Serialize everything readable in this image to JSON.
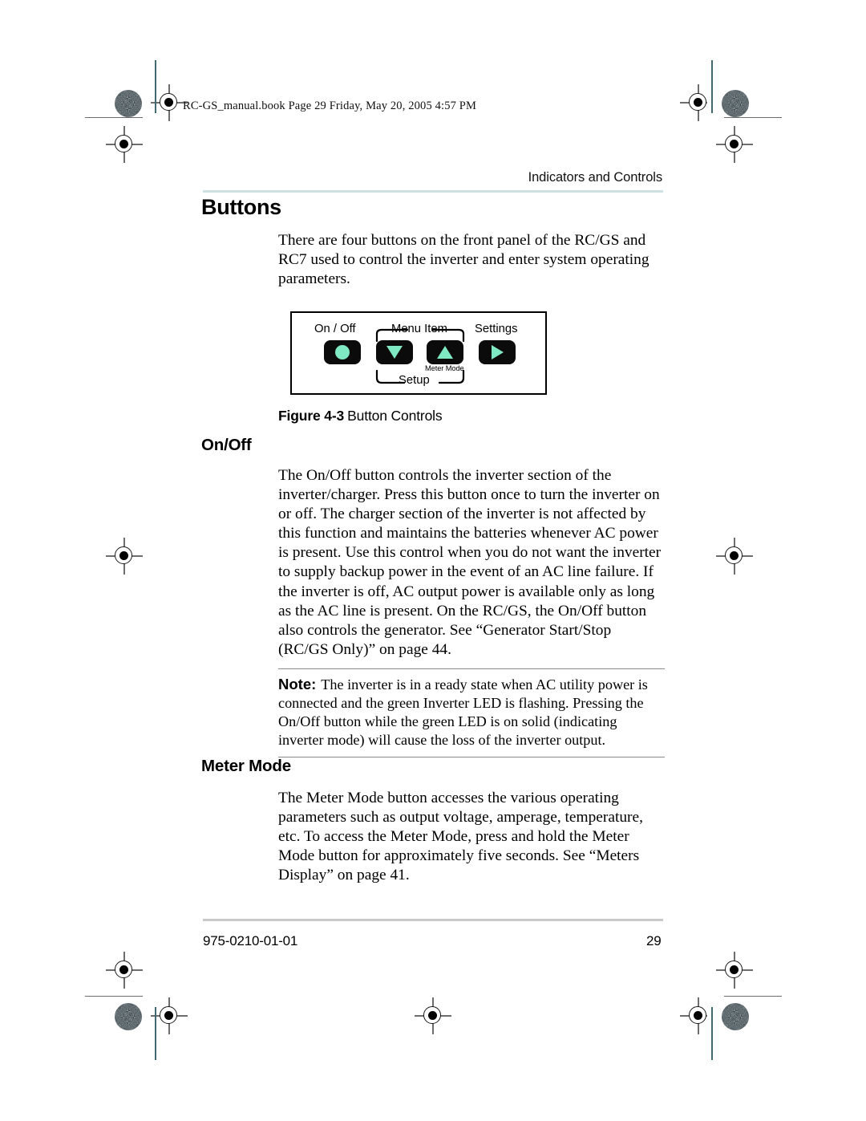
{
  "book_header": "RC-GS_manual.book  Page 29  Friday, May 20, 2005  4:57 PM",
  "running_head": "Indicators and Controls",
  "section_title": "Buttons",
  "intro_paragraph": "There are four buttons on the front panel of the RC/GS and RC7 used to control the inverter and enter system operating parameters.",
  "figure": {
    "labels": {
      "on_off": "On / Off",
      "menu_item": "Menu Item",
      "settings": "Settings",
      "setup": "Setup",
      "meter_mode": "Meter Mode"
    },
    "buttons": [
      {
        "name": "on-off-button",
        "glyph": "circle"
      },
      {
        "name": "menu-down-button",
        "glyph": "triangle-down"
      },
      {
        "name": "menu-up-button",
        "glyph": "triangle-up"
      },
      {
        "name": "settings-button",
        "glyph": "triangle-right"
      }
    ],
    "caption_number": "Figure 4-3",
    "caption_text": "Button Controls",
    "glyph_color": "#7fe9c3",
    "button_color": "#0b0b0b"
  },
  "sections": [
    {
      "heading": "On/Off",
      "body": "The On/Off button controls the inverter section of the inverter/charger. Press this button once to turn the inverter on or off. The charger section of the inverter is not affected by this function and maintains the batteries whenever AC power is present. Use this control when you do not want the inverter to supply backup power in the event of an AC line failure. If the inverter is off, AC output power is available only as long as the AC line is present. On the RC/GS, the On/Off button also controls the generator. See “Generator Start/Stop (RC/GS Only)” on page 44."
    },
    {
      "heading": "Meter Mode",
      "body": "The Meter Mode button accesses the various operating parameters such as output voltage, amperage, temperature, etc. To access the Meter Mode, press and hold the Meter Mode button for approximately five seconds. See “Meters Display” on page 41."
    }
  ],
  "note": {
    "label": "Note:",
    "text": "The inverter is in a ready state when AC utility power is connected and the green Inverter LED is flashing. Pressing the On/Off button while the green LED is on solid (indicating inverter mode) will cause the loss of the inverter output."
  },
  "footer": {
    "document_number": "975-0210-01-01",
    "page_number": "29"
  },
  "accent_colors": {
    "header_rule": "#cfe0e1",
    "guide_line": "#3f6b70",
    "footer_rule": "#c9c9c9"
  }
}
